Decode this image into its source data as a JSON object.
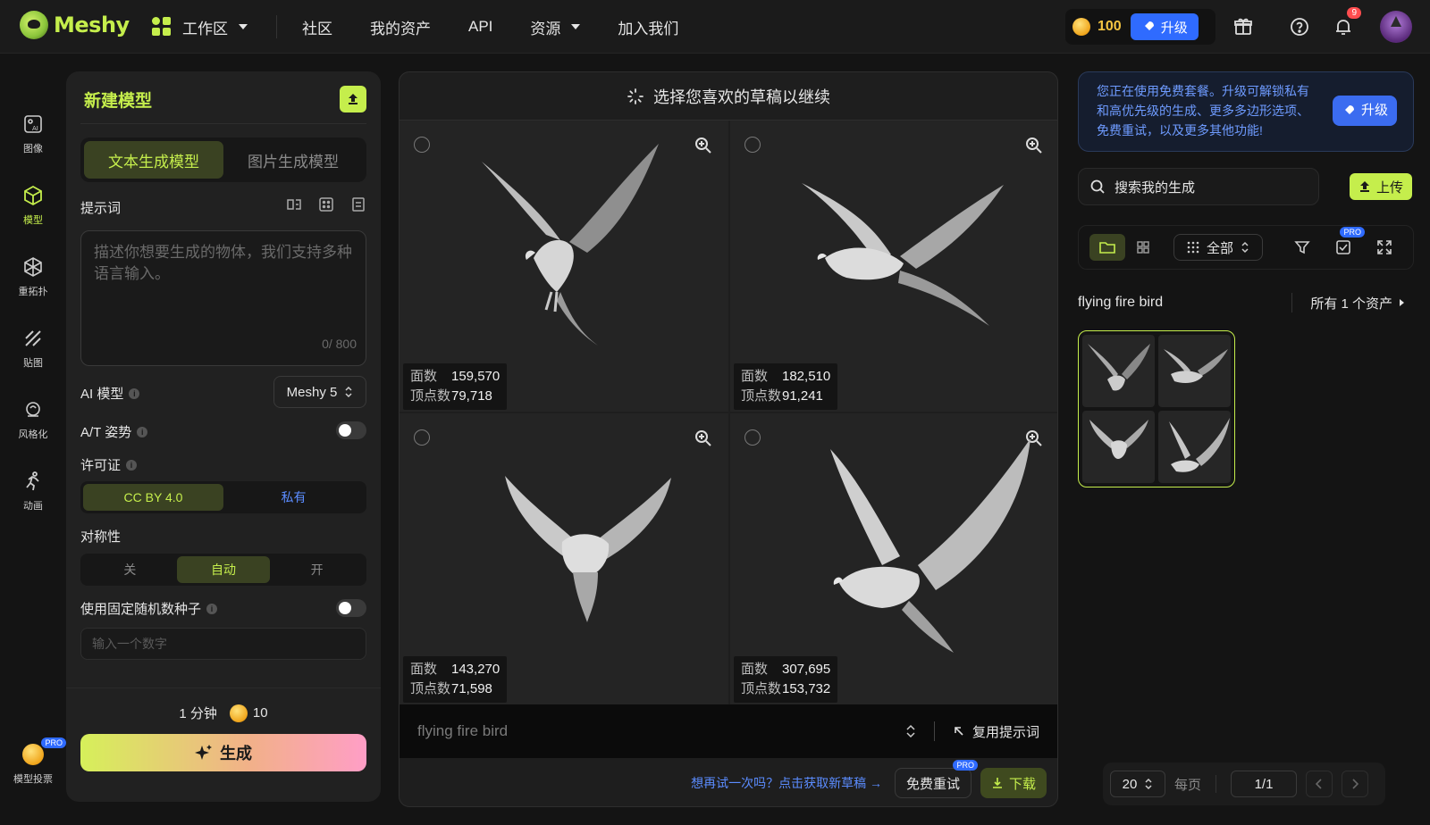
{
  "app": {
    "brand": "Meshy",
    "brand_color": "#c5ee4c"
  },
  "nav": {
    "items": [
      {
        "label": "工作区",
        "icon": "workspace-icon",
        "dropdown": true
      },
      {
        "label": "社区"
      },
      {
        "label": "我的资产"
      },
      {
        "label": "API"
      },
      {
        "label": "资源",
        "dropdown": true
      },
      {
        "label": "加入我们"
      }
    ]
  },
  "topbar": {
    "credits": "100",
    "upgrade_label": "升级",
    "notification_count": "9"
  },
  "rail": {
    "items": [
      {
        "label": "图像",
        "icon": "image-ai-icon"
      },
      {
        "label": "模型",
        "icon": "cube-icon",
        "active": true
      },
      {
        "label": "重拓扑",
        "icon": "retopology-icon"
      },
      {
        "label": "贴图",
        "icon": "texture-icon"
      },
      {
        "label": "风格化",
        "icon": "stylize-icon"
      },
      {
        "label": "动画",
        "icon": "running-figure-icon"
      }
    ],
    "vote_label": "模型投票",
    "vote_pro": "PRO"
  },
  "left_panel": {
    "title": "新建模型",
    "mode_tabs": [
      "文本生成模型",
      "图片生成模型"
    ],
    "active_mode": 0,
    "prompt_label": "提示词",
    "prompt_placeholder": "描述你想要生成的物体，我们支持多种语言输入。",
    "prompt_count": "0/ 800",
    "ai_model_label": "AI 模型",
    "ai_model_value": "Meshy 5",
    "pose_label": "A/T 姿势",
    "license_label": "许可证",
    "license_options": [
      "CC BY 4.0",
      "私有"
    ],
    "symmetry_label": "对称性",
    "symmetry_options": [
      "关",
      "自动",
      "开"
    ],
    "seed_label": "使用固定随机数种子",
    "seed_placeholder": "输入一个数字",
    "time_estimate": "1 分钟",
    "cost": "10",
    "generate_label": "生成"
  },
  "center": {
    "header": "选择您喜欢的草稿以继续",
    "tiles": [
      {
        "faces_label": "面数",
        "faces": "159,570",
        "verts_label": "顶点数",
        "verts": "79,718"
      },
      {
        "faces_label": "面数",
        "faces": "182,510",
        "verts_label": "顶点数",
        "verts": "91,241"
      },
      {
        "faces_label": "面数",
        "faces": "143,270",
        "verts_label": "顶点数",
        "verts": "71,598"
      },
      {
        "faces_label": "面数",
        "faces": "307,695",
        "verts_label": "顶点数",
        "verts": "153,732"
      }
    ],
    "prompt_text": "flying fire bird",
    "reuse_label": "复用提示词",
    "retry_link": "想再试一次吗？点击获取新草稿 →",
    "free_retry_label": "免费重试",
    "free_retry_pro": "PRO",
    "download_label": "下载"
  },
  "right_panel": {
    "promo_text": "您正在使用免费套餐。升级可解锁私有和高优先级的生成、更多多边形选项、免费重试，以及更多其他功能!",
    "promo_button": "升级",
    "search_placeholder": "搜索我的生成",
    "upload_label": "上传",
    "filter_label": "全部",
    "pro_tag": "PRO",
    "collection_title": "flying fire bird",
    "all_assets_label": "所有 1 个资产",
    "page_size": "20",
    "per_page_label": "每页",
    "page_indicator": "1/1"
  }
}
